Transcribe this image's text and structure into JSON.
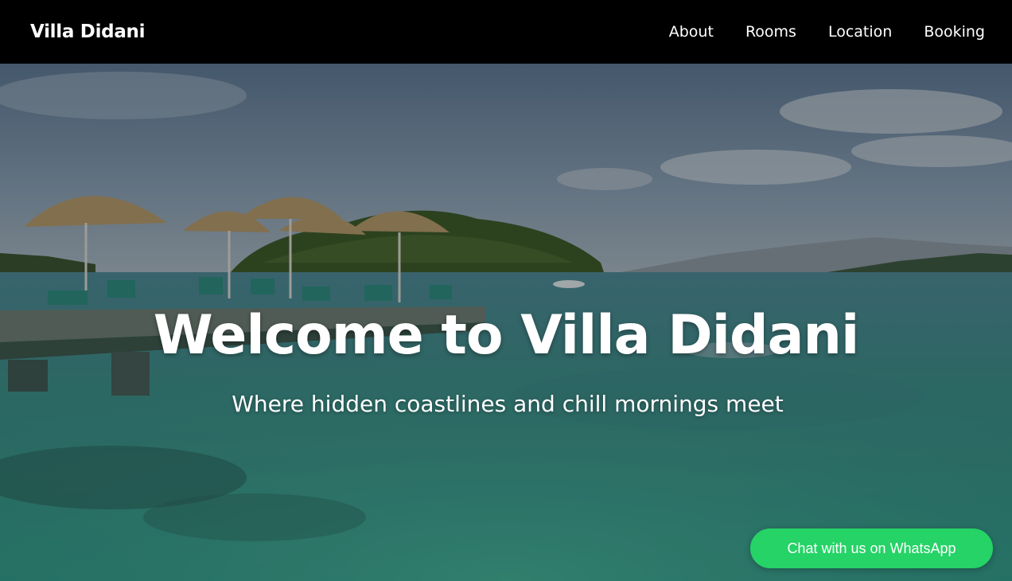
{
  "nav": {
    "brand": "Villa Didani",
    "links": [
      {
        "label": "About"
      },
      {
        "label": "Rooms"
      },
      {
        "label": "Location"
      },
      {
        "label": "Booking"
      }
    ]
  },
  "hero": {
    "title": "Welcome to Villa Didani",
    "subtitle": "Where hidden coastlines and chill mornings meet"
  },
  "whatsapp": {
    "label": "Chat with us on WhatsApp",
    "color": "#25d366"
  },
  "colors": {
    "navbar_bg": "#000000",
    "text": "#ffffff"
  }
}
